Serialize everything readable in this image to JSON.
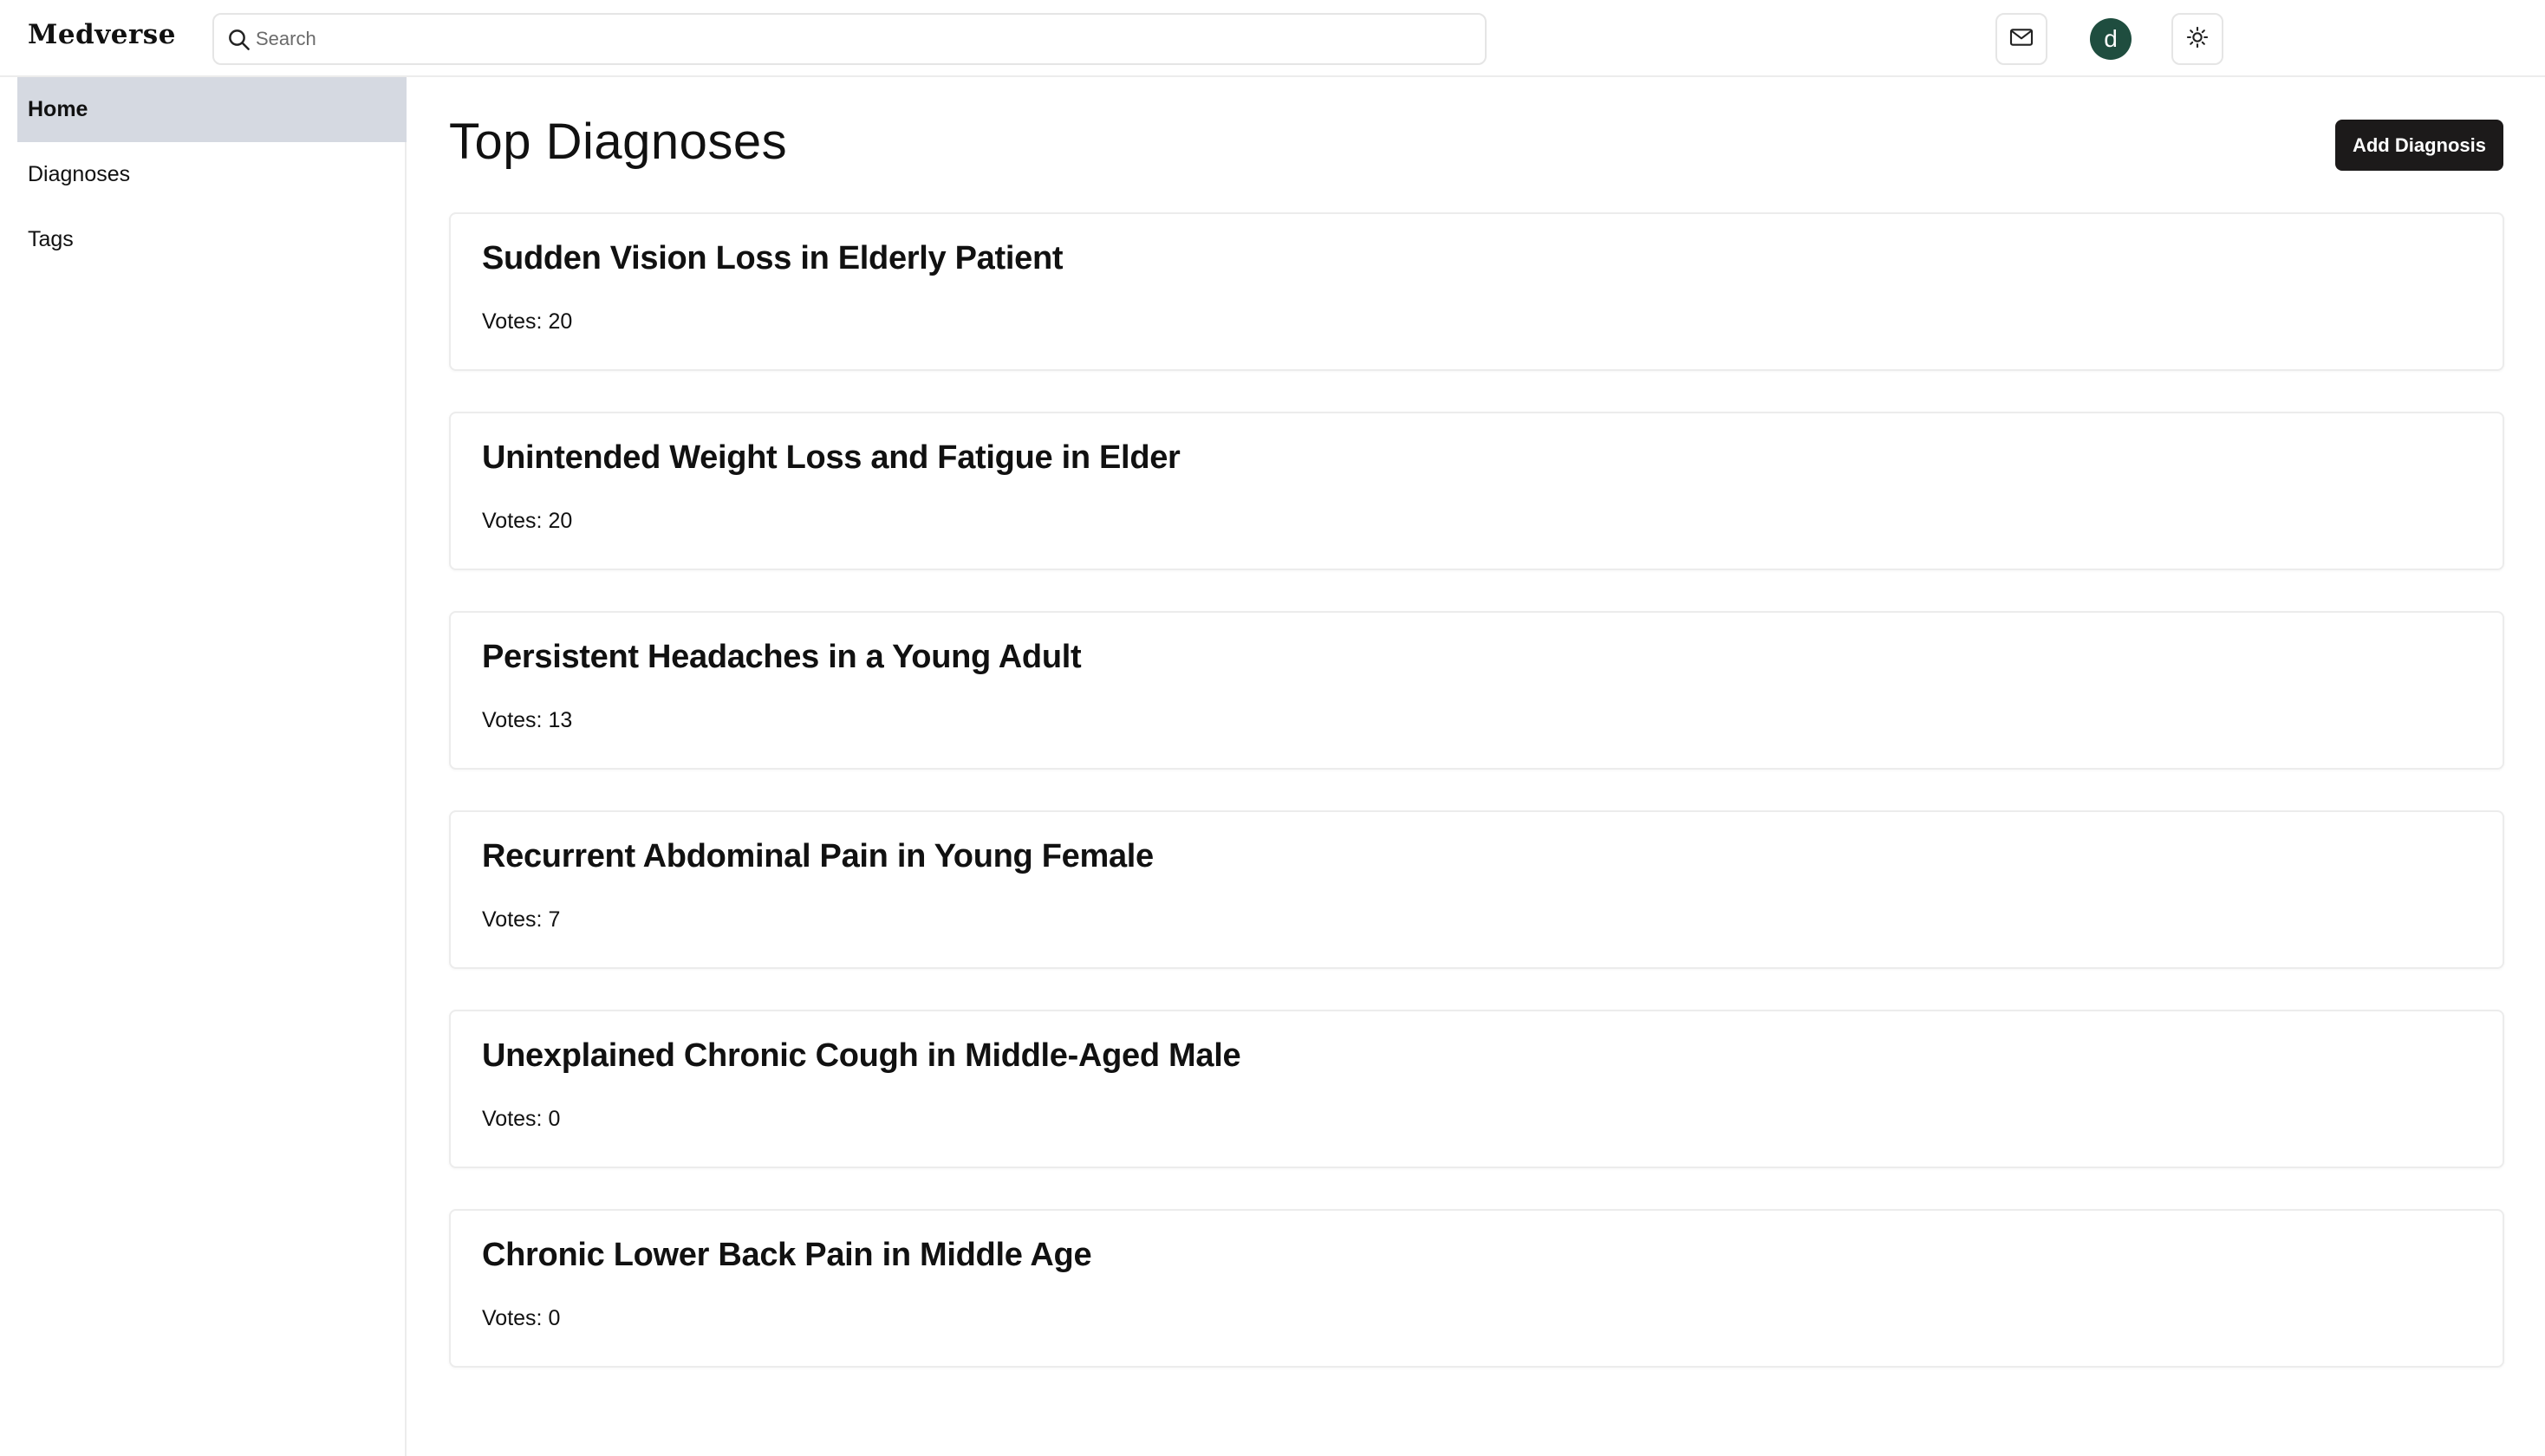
{
  "app": {
    "logo": "Medverse"
  },
  "search": {
    "placeholder": "Search",
    "value": ""
  },
  "header": {
    "avatar_letter": "d"
  },
  "sidebar": {
    "items": [
      {
        "label": "Home",
        "active": true
      },
      {
        "label": "Diagnoses",
        "active": false
      },
      {
        "label": "Tags",
        "active": false
      }
    ]
  },
  "main": {
    "title": "Top Diagnoses",
    "add_button": "Add Diagnosis",
    "cards": [
      {
        "title": "Sudden Vision Loss in Elderly Patient",
        "votes": "Votes: 20"
      },
      {
        "title": "Unintended Weight Loss and Fatigue in Elder",
        "votes": "Votes: 20"
      },
      {
        "title": "Persistent Headaches in a Young Adult",
        "votes": "Votes: 13"
      },
      {
        "title": "Recurrent Abdominal Pain in Young Female",
        "votes": "Votes: 7"
      },
      {
        "title": "Unexplained Chronic Cough in Middle-Aged Male",
        "votes": "Votes: 0"
      },
      {
        "title": "Chronic Lower Back Pain in Middle Age",
        "votes": "Votes: 0"
      }
    ]
  },
  "icons": {
    "search": "search-icon",
    "mail": "mail-icon",
    "theme": "sun-icon"
  },
  "colors": {
    "accent": "#1c1a1a",
    "avatar": "#1f4d3f",
    "nav_active": "#d5d9e1"
  }
}
